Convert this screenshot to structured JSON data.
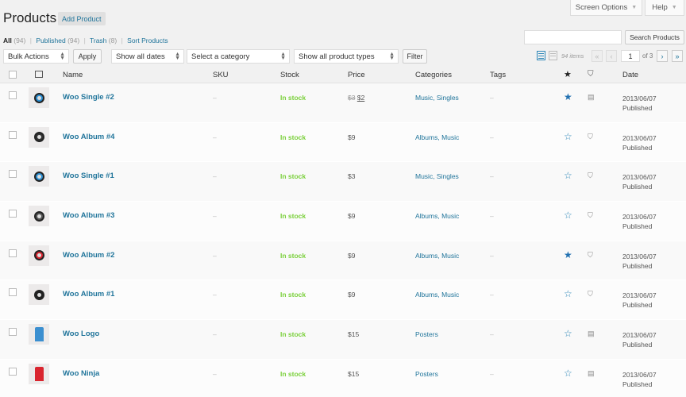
{
  "header": {
    "title": "Products",
    "add_button": "Add Product",
    "screen_options": "Screen Options",
    "help": "Help"
  },
  "filters": {
    "all_label": "All",
    "all_count": "(94)",
    "published_label": "Published",
    "published_count": "(94)",
    "trash_label": "Trash",
    "trash_count": "(8)",
    "sort_label": "Sort Products",
    "separator": "|"
  },
  "search": {
    "placeholder": "",
    "button": "Search Products"
  },
  "toolbar": {
    "bulk_actions": "Bulk Actions",
    "apply": "Apply",
    "dates": "Show all dates",
    "category": "Select a category",
    "product_types": "Show all product types",
    "filter": "Filter",
    "items_count": "94 items",
    "first": "«",
    "prev": "‹",
    "current_page": "1",
    "of_pages": "of 3",
    "next": "›",
    "last": "»"
  },
  "columns": {
    "name": "Name",
    "sku": "SKU",
    "stock": "Stock",
    "price": "Price",
    "categories": "Categories",
    "tags": "Tags",
    "featured_icon": "star-icon",
    "type_icon": "product-type-icon",
    "date": "Date"
  },
  "products": [
    {
      "name": "Woo Single #2",
      "sku": "–",
      "stock": "In stock",
      "price_old": "$3",
      "price": "$2",
      "categories": "Music, Singles",
      "tags": "–",
      "featured": true,
      "type_icon": "downloadable-icon",
      "date": "2013/06/07",
      "status": "Published",
      "thumb_color": "#2a8fd4",
      "thumb_icon": "album-thumb"
    },
    {
      "name": "Woo Album #4",
      "sku": "–",
      "stock": "In stock",
      "price_old": "",
      "price": "$9",
      "categories": "Albums, Music",
      "tags": "–",
      "featured": false,
      "type_icon": "virtual-icon",
      "date": "2013/06/07",
      "status": "Published",
      "thumb_color": "#333333",
      "thumb_icon": "album-thumb"
    },
    {
      "name": "Woo Single #1",
      "sku": "–",
      "stock": "In stock",
      "price_old": "",
      "price": "$3",
      "categories": "Music, Singles",
      "tags": "–",
      "featured": false,
      "type_icon": "virtual-icon",
      "date": "2013/06/07",
      "status": "Published",
      "thumb_color": "#2a8fd4",
      "thumb_icon": "album-thumb"
    },
    {
      "name": "Woo Album #3",
      "sku": "–",
      "stock": "In stock",
      "price_old": "",
      "price": "$9",
      "categories": "Albums, Music",
      "tags": "–",
      "featured": false,
      "type_icon": "virtual-icon",
      "date": "2013/06/07",
      "status": "Published",
      "thumb_color": "#555555",
      "thumb_icon": "album-thumb"
    },
    {
      "name": "Woo Album #2",
      "sku": "–",
      "stock": "In stock",
      "price_old": "",
      "price": "$9",
      "categories": "Albums, Music",
      "tags": "–",
      "featured": true,
      "type_icon": "virtual-icon",
      "date": "2013/06/07",
      "status": "Published",
      "thumb_color": "#d9252f",
      "thumb_icon": "album-thumb"
    },
    {
      "name": "Woo Album #1",
      "sku": "–",
      "stock": "In stock",
      "price_old": "",
      "price": "$9",
      "categories": "Albums, Music",
      "tags": "–",
      "featured": false,
      "type_icon": "virtual-icon",
      "date": "2013/06/07",
      "status": "Published",
      "thumb_color": "#222222",
      "thumb_icon": "album-thumb"
    },
    {
      "name": "Woo Logo",
      "sku": "–",
      "stock": "In stock",
      "price_old": "",
      "price": "$15",
      "categories": "Posters",
      "tags": "–",
      "featured": false,
      "type_icon": "downloadable-icon",
      "date": "2013/06/07",
      "status": "Published",
      "thumb_color": "#3b8fd0",
      "thumb_icon": "poster-thumb"
    },
    {
      "name": "Woo Ninja",
      "sku": "–",
      "stock": "In stock",
      "price_old": "",
      "price": "$15",
      "categories": "Posters",
      "tags": "–",
      "featured": false,
      "type_icon": "downloadable-icon",
      "date": "2013/06/07",
      "status": "Published",
      "thumb_color": "#d9252f",
      "thumb_icon": "poster-thumb"
    }
  ],
  "colors": {
    "link": "#21759b",
    "in_stock": "#7ad03a",
    "star": "#2271b1"
  }
}
